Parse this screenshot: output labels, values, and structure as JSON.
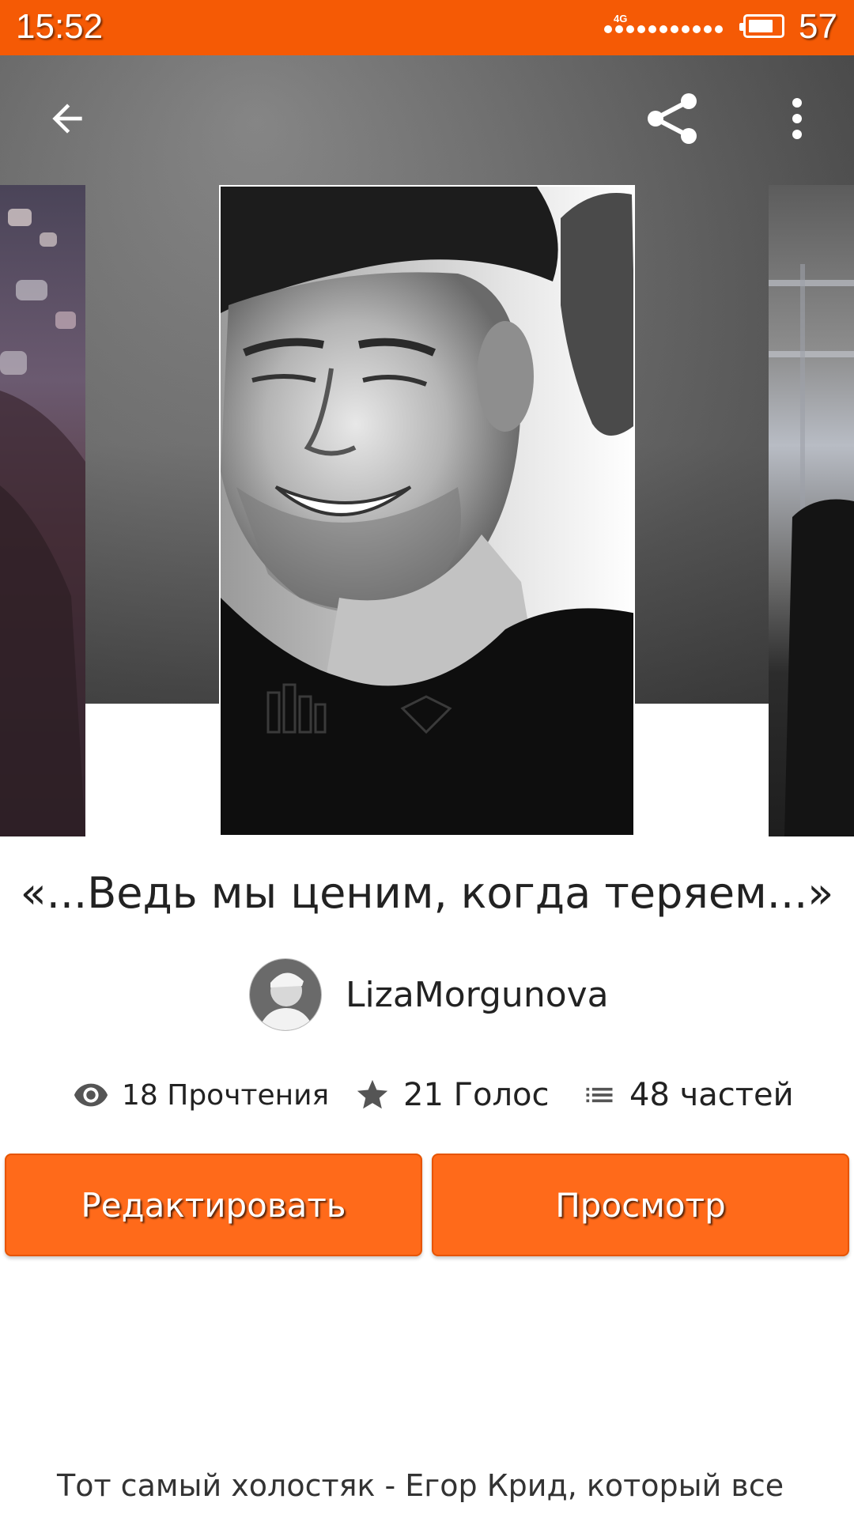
{
  "status_bar": {
    "time": "15:52",
    "network": "4G",
    "battery_level": "57",
    "background": "#f55a05"
  },
  "toolbar": {
    "back_icon": "arrow-left-icon",
    "share_icon": "share-icon",
    "more_icon": "more-vertical-icon"
  },
  "story": {
    "title": "«...Ведь мы ценим, когда теряем...»",
    "author": "LizaMorgunova",
    "stats": {
      "reads": "18 Прочтения",
      "votes": "21 Голос",
      "parts": "48 частей"
    },
    "description": "Тот самый холостяк - Егор Крид, который все"
  },
  "buttons": {
    "edit": "Редактировать",
    "view": "Просмотр"
  },
  "colors": {
    "accent": "#ff6a1a",
    "accent_border": "#e65400",
    "text": "#222222"
  }
}
